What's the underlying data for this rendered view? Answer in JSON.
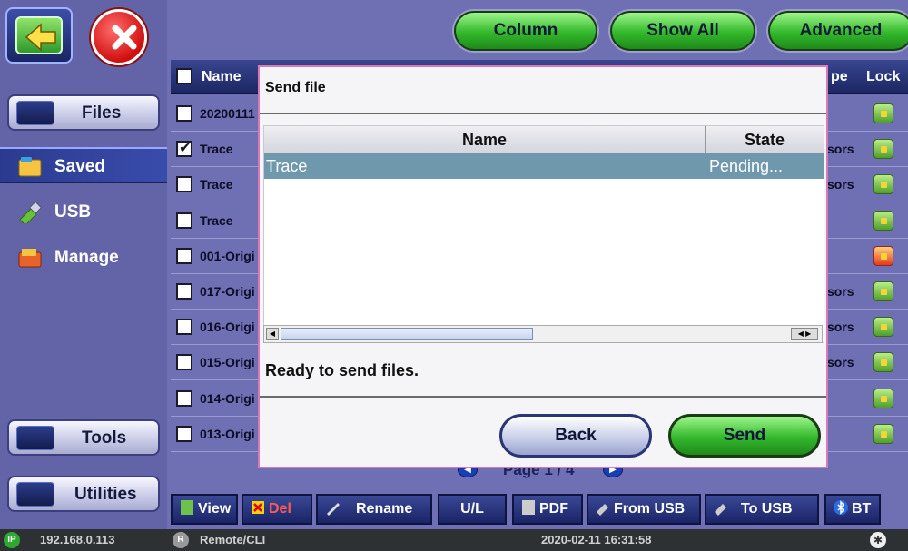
{
  "toolbar_top": {
    "column": "Column",
    "show_all": "Show All",
    "advanced": "Advanced"
  },
  "sidebar": {
    "files": "Files",
    "saved": "Saved",
    "usb": "USB",
    "manage": "Manage",
    "tools": "Tools",
    "utilities": "Utilities"
  },
  "table": {
    "headers": {
      "name": "Name",
      "type": "pe",
      "lock": "Lock"
    },
    "rows": [
      {
        "name": "20200111",
        "type": "",
        "checked": false,
        "locked": false
      },
      {
        "name": "Trace",
        "type": "sors",
        "checked": true,
        "locked": false
      },
      {
        "name": "Trace",
        "type": "sors",
        "checked": false,
        "locked": false
      },
      {
        "name": "Trace",
        "type": "",
        "checked": false,
        "locked": false
      },
      {
        "name": "001-Origi",
        "type": "",
        "checked": false,
        "locked": true
      },
      {
        "name": "017-Origi",
        "type": "sors",
        "checked": false,
        "locked": false
      },
      {
        "name": "016-Origi",
        "type": "sors",
        "checked": false,
        "locked": false
      },
      {
        "name": "015-Origi",
        "type": "sors",
        "checked": false,
        "locked": false
      },
      {
        "name": "014-Origi",
        "type": "",
        "checked": false,
        "locked": false
      },
      {
        "name": "013-Origi",
        "type": "",
        "checked": false,
        "locked": false
      }
    ]
  },
  "page_nav": {
    "label": "Page 1 / 4"
  },
  "bottom_toolbar": {
    "view": "View",
    "del": "Del",
    "rename": "Rename",
    "ul": "U/L",
    "pdf": "PDF",
    "from_usb": "From USB",
    "to_usb": "To USB",
    "bt": "BT"
  },
  "status_bar": {
    "ip_badge": "IP",
    "ip": "192.168.0.113",
    "remote_badge": "R",
    "remote": "Remote/CLI",
    "datetime": "2020-02-11  16:31:58"
  },
  "dialog": {
    "title": "Send file",
    "columns": {
      "name": "Name",
      "state": "State"
    },
    "selected_row": {
      "name": "Trace",
      "state": "Pending..."
    },
    "status": "Ready to send files.",
    "back": "Back",
    "send": "Send"
  },
  "colors": {
    "accent_green": "#33b82c",
    "panel": "#6f6fb4",
    "selection": "#6f98ad"
  }
}
